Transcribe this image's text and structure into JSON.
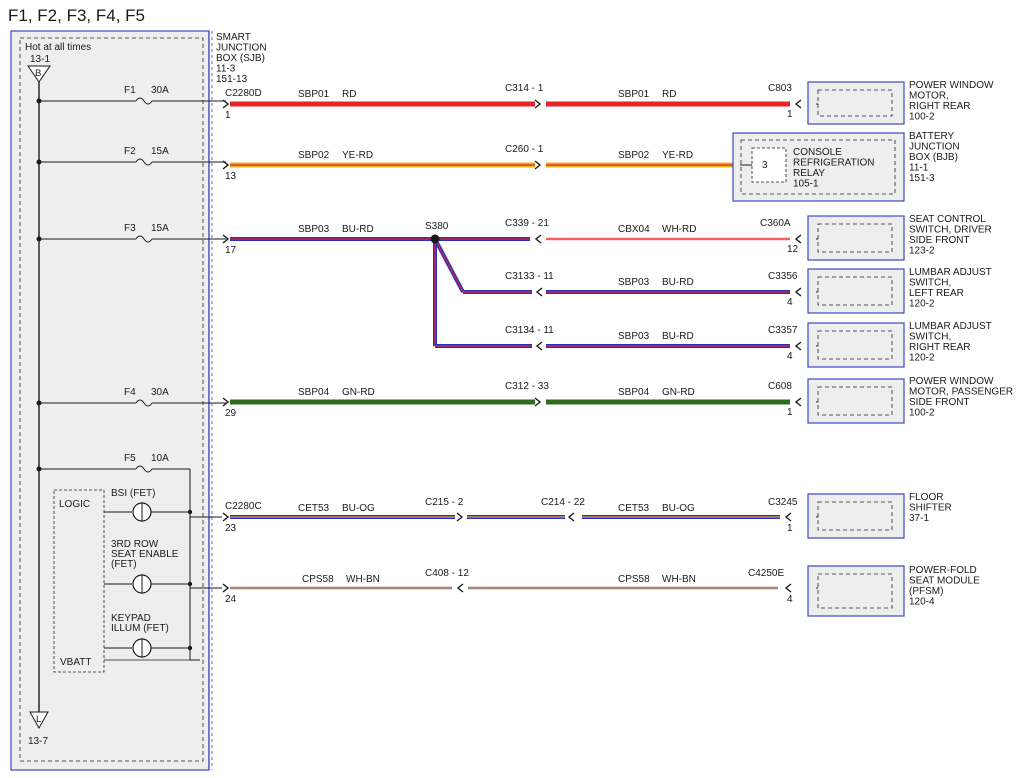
{
  "title": "F1, F2, F3, F4, F5",
  "sjb": {
    "hot_label": "Hot at all times",
    "top_ref": "13-1",
    "top_letter": "B",
    "bottom_ref": "13-7",
    "bottom_letter": "L",
    "name_lines": [
      "SMART",
      "JUNCTION",
      "BOX (SJB)",
      "11-3",
      "151-13"
    ]
  },
  "fuses": [
    {
      "name": "F1",
      "rating": "30A"
    },
    {
      "name": "F2",
      "rating": "15A"
    },
    {
      "name": "F3",
      "rating": "15A"
    },
    {
      "name": "F4",
      "rating": "30A"
    },
    {
      "name": "F5",
      "rating": "10A"
    }
  ],
  "logic": {
    "title": "LOGIC",
    "vbatt": "VBATT",
    "outputs": [
      {
        "lines": [
          "BSI (FET)"
        ]
      },
      {
        "lines": [
          "3RD ROW",
          "SEAT ENABLE",
          "(FET)"
        ]
      },
      {
        "lines": [
          "KEYPAD",
          "ILLUM (FET)"
        ]
      }
    ]
  },
  "sjb_connectors": [
    {
      "name": "C2280D",
      "pin": "1"
    },
    {
      "name": "",
      "pin": "13"
    },
    {
      "name": "",
      "pin": "17"
    },
    {
      "name": "",
      "pin": "29"
    },
    {
      "name": "C2280C",
      "pin": "23"
    },
    {
      "name": "",
      "pin": "24"
    }
  ],
  "splice": "S380",
  "circuits": [
    {
      "left_circuit": "SBP01",
      "left_color": "RD",
      "inline": "C314 - 1",
      "right_circuit": "SBP01",
      "right_color": "RD",
      "end_conn": "C803",
      "end_pin": "1"
    },
    {
      "left_circuit": "SBP02",
      "left_color": "YE-RD",
      "inline": "C260 - 1",
      "right_circuit": "SBP02",
      "right_color": "YE-RD",
      "end_conn": "",
      "end_pin": ""
    },
    {
      "left_circuit": "SBP03",
      "left_color": "BU-RD",
      "inline": "C339 - 21",
      "right_circuit": "CBX04",
      "right_color": "WH-RD",
      "end_conn": "C360A",
      "end_pin": "12"
    },
    {
      "left_circuit": "",
      "left_color": "",
      "inline": "C3133 - 11",
      "right_circuit": "SBP03",
      "right_color": "BU-RD",
      "end_conn": "C3356",
      "end_pin": "4"
    },
    {
      "left_circuit": "",
      "left_color": "",
      "inline": "C3134 - 11",
      "right_circuit": "SBP03",
      "right_color": "BU-RD",
      "end_conn": "C3357",
      "end_pin": "4"
    },
    {
      "left_circuit": "SBP04",
      "left_color": "GN-RD",
      "inline": "C312 - 33",
      "right_circuit": "SBP04",
      "right_color": "GN-RD",
      "end_conn": "C608",
      "end_pin": "1"
    },
    {
      "left_circuit": "CET53",
      "left_color": "BU-OG",
      "inline": "C215 - 2",
      "inline2": "C214 - 22",
      "right_circuit": "CET53",
      "right_color": "BU-OG",
      "end_conn": "C3245",
      "end_pin": "1"
    },
    {
      "left_circuit": "CPS58",
      "left_color": "WH-BN",
      "inline": "C408 - 12",
      "right_circuit": "CPS58",
      "right_color": "WH-BN",
      "end_conn": "C4250E",
      "end_pin": "4"
    }
  ],
  "bjb_relay": {
    "pin": "3",
    "lines": [
      "CONSOLE",
      "REFRIGERATION",
      "RELAY",
      "105-1"
    ]
  },
  "components": [
    {
      "lines": [
        "POWER WINDOW",
        "MOTOR,",
        "RIGHT REAR",
        "100-2"
      ]
    },
    {
      "lines": [
        "BATTERY",
        "JUNCTION",
        "BOX (BJB)",
        "11-1",
        "151-3"
      ]
    },
    {
      "lines": [
        "SEAT CONTROL",
        "SWITCH, DRIVER",
        "SIDE FRONT",
        "123-2"
      ]
    },
    {
      "lines": [
        "LUMBAR ADJUST",
        "SWITCH,",
        "LEFT REAR",
        "120-2"
      ]
    },
    {
      "lines": [
        "LUMBAR ADJUST",
        "SWITCH,",
        "RIGHT REAR",
        "120-2"
      ]
    },
    {
      "lines": [
        "POWER WINDOW",
        "MOTOR, PASSENGER",
        "SIDE FRONT",
        "100-2"
      ]
    },
    {
      "lines": [
        "FLOOR",
        "SHIFTER",
        "37-1"
      ]
    },
    {
      "lines": [
        "POWER-FOLD",
        "SEAT MODULE",
        "(PFSM)",
        "120-4"
      ]
    }
  ],
  "wire_colors": {
    "RD": "#e8232a",
    "YE-RD": "#e3b21c",
    "BU-RD": "#2a2fbf",
    "WH-RD": "#e9b8b8",
    "GN-RD": "#2e6a1f",
    "BU-OG": "#2a2fbf",
    "WH-BN": "#c9b9b0",
    "stripe_red": "#e8232a",
    "stripe_bright_red": "#ff2a2a",
    "stripe_orange": "#f2a13a",
    "stripe_brown": "#9a6a4a",
    "frame_blue": "#3d45c8"
  }
}
